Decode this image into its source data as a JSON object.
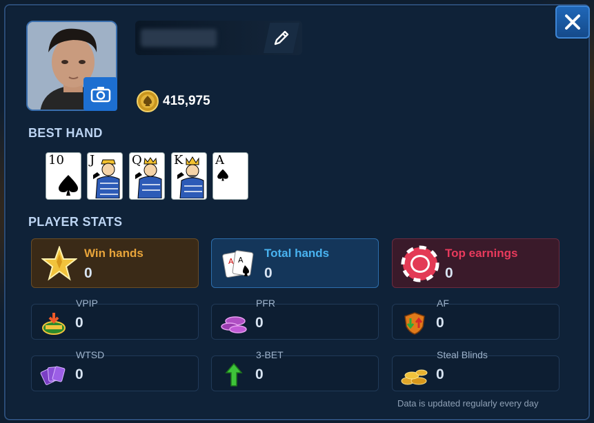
{
  "player": {
    "chips": "415,975"
  },
  "sections": {
    "best_hand": "BEST HAND",
    "player_stats": "PLAYER STATS"
  },
  "best_hand_cards": [
    {
      "rank": "10",
      "suit": "spades"
    },
    {
      "rank": "J",
      "suit": "spades"
    },
    {
      "rank": "Q",
      "suit": "spades"
    },
    {
      "rank": "K",
      "suit": "spades"
    },
    {
      "rank": "A",
      "suit": "spades"
    }
  ],
  "main_stats": [
    {
      "label": "Win hands",
      "value": "0",
      "color": "#e8a43a",
      "icon": "star-icon"
    },
    {
      "label": "Total hands",
      "value": "0",
      "color": "#49b3f0",
      "icon": "playing-cards-icon"
    },
    {
      "label": "Top earnings",
      "value": "0",
      "color": "#e83a5c",
      "icon": "poker-chip-icon"
    }
  ],
  "detail_stats": [
    {
      "label": "VPIP",
      "value": "0",
      "icon": "money-pot-icon"
    },
    {
      "label": "PFR",
      "value": "0",
      "icon": "chips-stack-icon"
    },
    {
      "label": "AF",
      "value": "0",
      "icon": "shield-arrows-icon"
    },
    {
      "label": "WTSD",
      "value": "0",
      "icon": "card-fan-icon"
    },
    {
      "label": "3-BET",
      "value": "0",
      "icon": "green-arrow-up-icon"
    },
    {
      "label": "Steal Blinds",
      "value": "0",
      "icon": "gold-coins-icon"
    }
  ],
  "footer": {
    "note": "Data is updated regularly every day"
  }
}
